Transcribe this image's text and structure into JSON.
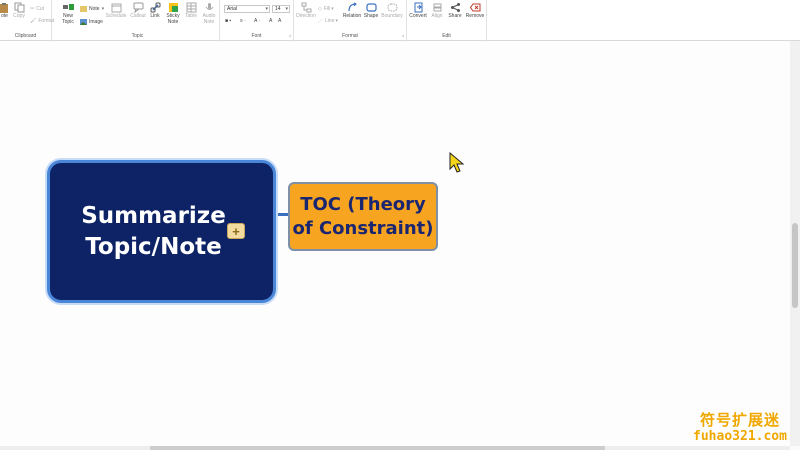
{
  "ribbon": {
    "clipboard": {
      "paste": "ote",
      "copy": "Copy",
      "cut": "Cut",
      "format": "Format",
      "group_label": "Clipboard"
    },
    "topic": {
      "new_topic": "New",
      "new_topic_2": "Topic",
      "note": "Note",
      "image": "Image",
      "schedule": "Schedule",
      "callout": "Callout",
      "link": "Link",
      "sticky": "Sticky",
      "sticky_2": "Note",
      "table": "Table",
      "audio": "Audio",
      "audio_2": "Note",
      "group_label": "Topic"
    },
    "font": {
      "font_name": "Arial",
      "font_size": "14",
      "group_label": "Font"
    },
    "format": {
      "direction": "Direction",
      "fill": "Fill",
      "line": "Line",
      "relation": "Relation",
      "shape": "Shape",
      "boundary": "Boundary",
      "group_label": "Format"
    },
    "edit": {
      "convert": "Convert",
      "align": "Align",
      "share": "Share",
      "remove": "Remove",
      "group_label": "Edit"
    }
  },
  "canvas": {
    "central_topic": "Summarize Topic/Note",
    "subtopic": "TOC (Theory of Constraint)"
  },
  "watermark": {
    "line1": "符号扩展迷",
    "line2": "fuhao321.com"
  },
  "colors": {
    "central_fill": "#0d2366",
    "central_border": "#4a86d8",
    "subtopic_fill": "#f7a521",
    "subtopic_text": "#1b2670",
    "watermark": "#f0a800"
  }
}
